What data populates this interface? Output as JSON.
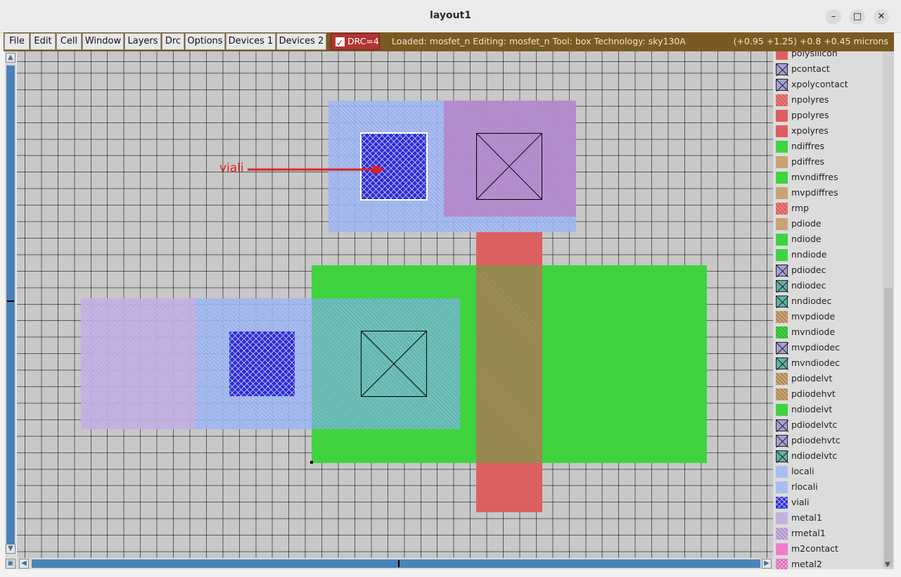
{
  "window": {
    "title": "layout1",
    "minimize": "–",
    "maximize": "□",
    "close": "✕"
  },
  "menu": [
    "File",
    "Edit",
    "Cell",
    "Window",
    "Layers",
    "Drc",
    "Options",
    "Devices 1",
    "Devices 2"
  ],
  "drc": {
    "label": "DRC=4",
    "checked": true
  },
  "status": "Loaded: mosfet_n Editing: mosfet_n Tool: box  Technology: sky130A",
  "coords": "(+0.95 +1.25) +0.8 +0.45 microns",
  "annotation": {
    "text": "viali",
    "color": "#e02020"
  },
  "colors": {
    "menubar": "#7a5a22",
    "scroll": "#4a82b8",
    "ndiff": "#3fd33f",
    "poly": "#dd6060",
    "viali": "#2c2cd6"
  },
  "layers": [
    {
      "name": "polysilicon",
      "swatch": "poly"
    },
    {
      "name": "pcontact",
      "swatch": "xcontact"
    },
    {
      "name": "xpolycontact",
      "swatch": "xcontact"
    },
    {
      "name": "npolyres",
      "swatch": "poly-hatch"
    },
    {
      "name": "ppolyres",
      "swatch": "poly"
    },
    {
      "name": "xpolyres",
      "swatch": "poly"
    },
    {
      "name": "ndiffres",
      "swatch": "green"
    },
    {
      "name": "pdiffres",
      "swatch": "tan"
    },
    {
      "name": "mvndiffres",
      "swatch": "green"
    },
    {
      "name": "mvpdiffres",
      "swatch": "tan"
    },
    {
      "name": "rmp",
      "swatch": "poly-hatch"
    },
    {
      "name": "pdiode",
      "swatch": "tan"
    },
    {
      "name": "ndiode",
      "swatch": "green"
    },
    {
      "name": "nndiode",
      "swatch": "green"
    },
    {
      "name": "pdiodec",
      "swatch": "xcontact"
    },
    {
      "name": "ndiodec",
      "swatch": "xteal"
    },
    {
      "name": "nndiodec",
      "swatch": "xteal"
    },
    {
      "name": "mvpdiode",
      "swatch": "tan-hatch"
    },
    {
      "name": "mvndiode",
      "swatch": "green-hatch"
    },
    {
      "name": "mvpdiodec",
      "swatch": "xcontact"
    },
    {
      "name": "mvndiodec",
      "swatch": "xteal"
    },
    {
      "name": "pdiodelvt",
      "swatch": "tan-hatch"
    },
    {
      "name": "pdiodehvt",
      "swatch": "tan-hatch"
    },
    {
      "name": "ndiodelvt",
      "swatch": "green"
    },
    {
      "name": "pdiodelvtc",
      "swatch": "xcontact"
    },
    {
      "name": "pdiodehvtc",
      "swatch": "xcontact"
    },
    {
      "name": "ndiodelvtc",
      "swatch": "xteal"
    },
    {
      "name": "locali",
      "swatch": "blue-hatch"
    },
    {
      "name": "rlocali",
      "swatch": "blue-hatch"
    },
    {
      "name": "viali",
      "swatch": "viali"
    },
    {
      "name": "metal1",
      "swatch": "metal1"
    },
    {
      "name": "rmetal1",
      "swatch": "metal1-hatch"
    },
    {
      "name": "m2contact",
      "swatch": "pink"
    },
    {
      "name": "metal2",
      "swatch": "pink-hatch"
    }
  ]
}
